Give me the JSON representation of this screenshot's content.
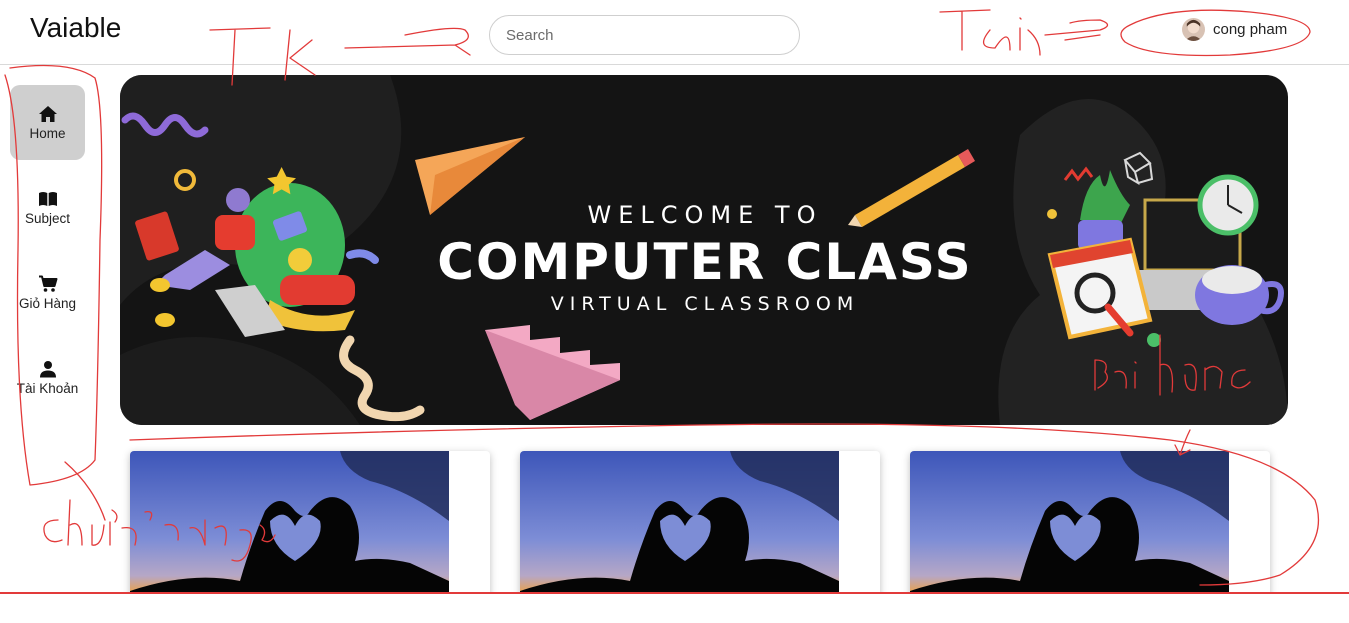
{
  "header": {
    "brand": "Vaiable",
    "search_placeholder": "Search",
    "user_name": "cong pham"
  },
  "sidebar": {
    "items": [
      {
        "label": "Home",
        "icon": "home-icon",
        "active": true
      },
      {
        "label": "Subject",
        "icon": "book-icon",
        "active": false
      },
      {
        "label": "Giỏ Hàng",
        "icon": "cart-icon",
        "active": false
      },
      {
        "label": "Tài Khoản",
        "icon": "person-icon",
        "active": false
      }
    ]
  },
  "banner": {
    "welcome": "WELCOME TO",
    "headline": "COMPUTER CLASS",
    "subline": "VIRTUAL CLASSROOM"
  },
  "cards": [
    {
      "image": "heart-hands-sunset-image"
    },
    {
      "image": "heart-hands-sunset-image"
    },
    {
      "image": "heart-hands-sunset-image"
    }
  ],
  "annotations": {
    "color": "#e23a3a",
    "notes": [
      "Tk",
      "Tài",
      "Bài học",
      "Chức năng"
    ]
  },
  "colors": {
    "banner_bg": "#141414",
    "active_nav_bg": "#cfcfcf",
    "annotation": "#e23a3a"
  }
}
